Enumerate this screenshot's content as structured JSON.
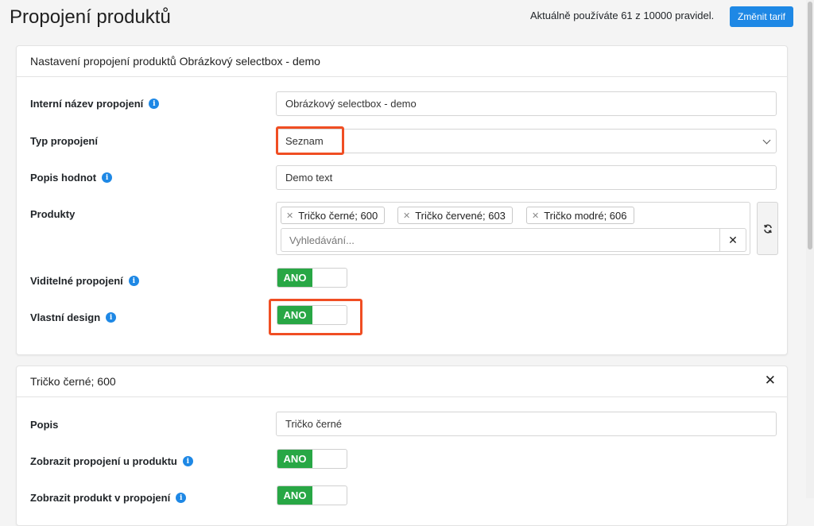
{
  "page": {
    "title": "Propojení produktů",
    "usage_text": "Aktuálně používáte 61 z 10000 pravidel.",
    "tariff_button": "Změnit tarif"
  },
  "settings_card": {
    "title": "Nastavení propojení produktů Obrázkový selectbox - demo",
    "internal_name": {
      "label": "Interní název propojení",
      "value": "Obrázkový selectbox - demo"
    },
    "type": {
      "label": "Typ propojení",
      "value": "Seznam"
    },
    "values_desc": {
      "label": "Popis hodnot",
      "value": "Demo text"
    },
    "products": {
      "label": "Produkty",
      "tags": [
        "Tričko černé; 600",
        "Tričko červené; 603",
        "Tričko modré; 606"
      ],
      "search_placeholder": "Vyhledávání..."
    },
    "visible": {
      "label": "Viditelné propojení",
      "value": "ANO"
    },
    "custom_design": {
      "label": "Vlastní design",
      "value": "ANO"
    }
  },
  "product_card": {
    "title": "Tričko černé; 600",
    "description": {
      "label": "Popis",
      "value": "Tričko černé"
    },
    "show_link": {
      "label": "Zobrazit propojení u produktu",
      "value": "ANO"
    },
    "show_product": {
      "label": "Zobrazit produkt v propojení",
      "value": "ANO"
    }
  },
  "icons": {
    "info": "info-icon",
    "remove": "x-icon",
    "refresh": "refresh-icon",
    "close": "close-icon",
    "caret": "chevron-down-icon"
  },
  "colors": {
    "primary": "#1e88e5",
    "toggle_on": "#28a745",
    "highlight": "#f04e23"
  }
}
